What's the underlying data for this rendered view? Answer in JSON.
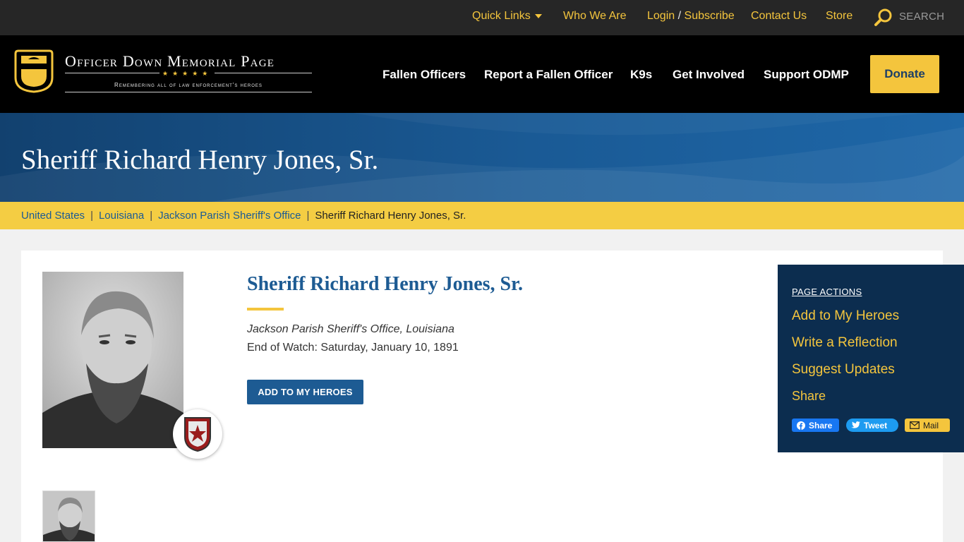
{
  "topbar": {
    "quick_links": "Quick Links",
    "who_we_are": "Who We Are",
    "login": "Login",
    "slash": "/",
    "subscribe": "Subscribe",
    "contact_us": "Contact Us",
    "store": "Store",
    "search": "SEARCH"
  },
  "logo": {
    "title": "Officer Down Memorial Page",
    "stars": "★★★★★",
    "tagline": "Remembering all of law enforcement's heroes"
  },
  "nav": {
    "fallen_officers": "Fallen Officers",
    "report": "Report a Fallen Officer",
    "k9s": "K9s",
    "get_involved": "Get Involved",
    "support": "Support ODMP",
    "donate": "Donate"
  },
  "hero": {
    "title": "Sheriff Richard Henry Jones, Sr."
  },
  "breadcrumb": {
    "items": [
      "United States",
      "Louisiana",
      "Jackson Parish Sheriff's Office"
    ],
    "separator": "|",
    "current": "Sheriff Richard Henry Jones, Sr."
  },
  "officer": {
    "name": "Sheriff Richard Henry Jones, Sr.",
    "agency": "Jackson Parish Sheriff's Office, Louisiana",
    "end_of_watch": "End of Watch: Saturday, January 10, 1891",
    "add_button": "ADD TO MY HEROES"
  },
  "page_actions": {
    "heading": "PAGE ACTIONS",
    "add_to_heroes": "Add to My Heroes",
    "write_reflection": "Write a Reflection",
    "suggest_updates": "Suggest Updates",
    "share": "Share",
    "facebook": "Share",
    "tweet": "Tweet",
    "mail": "Mail"
  },
  "colors": {
    "accent_yellow": "#f4c53d",
    "brand_blue": "#1d5b93",
    "panel_navy": "#0c2d4f"
  }
}
